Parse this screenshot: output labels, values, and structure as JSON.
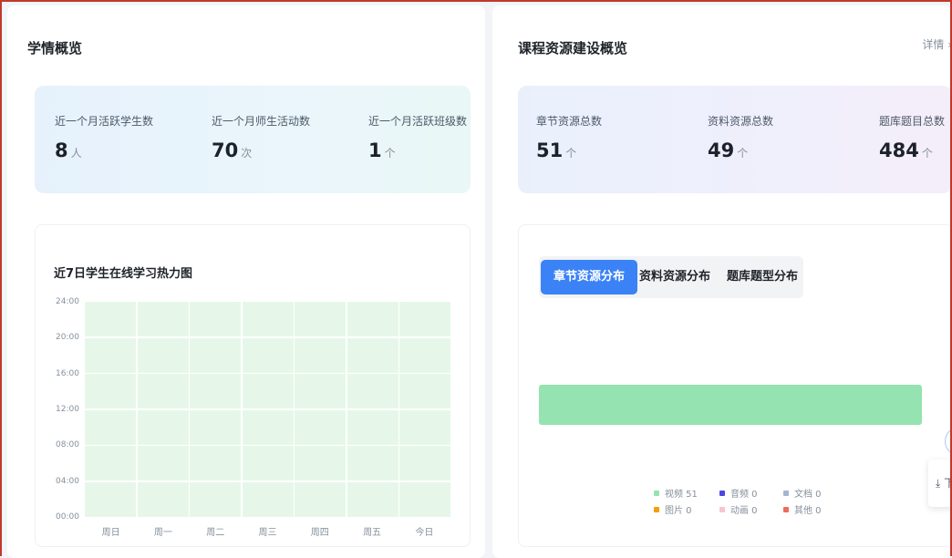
{
  "left": {
    "title": "学情概览",
    "stats": [
      {
        "label": "近一个月活跃学生数",
        "value": "8",
        "unit": "人"
      },
      {
        "label": "近一个月师生活动数",
        "value": "70",
        "unit": "次"
      },
      {
        "label": "近一个月活跃班级数",
        "value": "1",
        "unit": "个"
      }
    ],
    "heatmap": {
      "title": "近7日学生在线学习热力图",
      "y_ticks": [
        "24:00",
        "20:00",
        "16:00",
        "12:00",
        "08:00",
        "04:00",
        "00:00"
      ],
      "x_ticks": [
        "周日",
        "周一",
        "周二",
        "周三",
        "周四",
        "周五",
        "今日"
      ],
      "cell_color": "#e6f7e9"
    }
  },
  "right": {
    "title": "课程资源建设概览",
    "details_label": "详情 ›",
    "stats": [
      {
        "label": "章节资源总数",
        "value": "51",
        "unit": "个"
      },
      {
        "label": "资料资源总数",
        "value": "49",
        "unit": "个"
      },
      {
        "label": "题库题目总数",
        "value": "484",
        "unit": "个"
      }
    ],
    "tabs": [
      {
        "label": "章节资源分布",
        "active": true
      },
      {
        "label": "资料资源分布",
        "active": false
      },
      {
        "label": "题库题型分布",
        "active": false
      }
    ],
    "accent_color": "#3b82f6",
    "legend": [
      {
        "label": "视频 51",
        "color": "#94e3b0",
        "value": 51
      },
      {
        "label": "音频 0",
        "color": "#4f46e5",
        "value": 0
      },
      {
        "label": "文档 0",
        "color": "#a5b4d4",
        "value": 0
      },
      {
        "label": "图片 0",
        "color": "#f59e0b",
        "value": 0
      },
      {
        "label": "动画 0",
        "color": "#f9c4d2",
        "value": 0
      },
      {
        "label": "其他 0",
        "color": "#ef6b5b",
        "value": 0
      }
    ]
  },
  "side_tools": {
    "download_label": "⤓ 下"
  }
}
